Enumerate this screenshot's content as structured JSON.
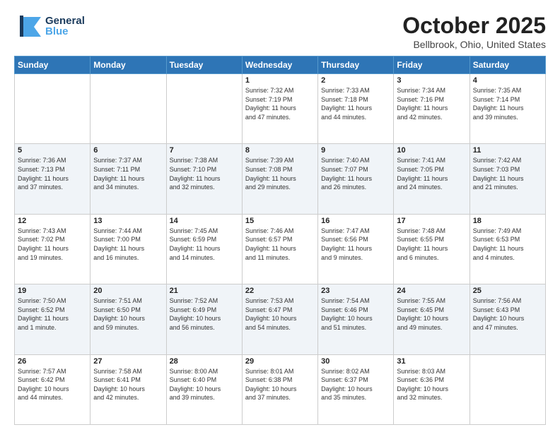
{
  "header": {
    "logo_general": "General",
    "logo_blue": "Blue",
    "month_title": "October 2025",
    "location": "Bellbrook, Ohio, United States"
  },
  "days_of_week": [
    "Sunday",
    "Monday",
    "Tuesday",
    "Wednesday",
    "Thursday",
    "Friday",
    "Saturday"
  ],
  "weeks": [
    [
      {
        "day": "",
        "info": ""
      },
      {
        "day": "",
        "info": ""
      },
      {
        "day": "",
        "info": ""
      },
      {
        "day": "1",
        "info": "Sunrise: 7:32 AM\nSunset: 7:19 PM\nDaylight: 11 hours\nand 47 minutes."
      },
      {
        "day": "2",
        "info": "Sunrise: 7:33 AM\nSunset: 7:18 PM\nDaylight: 11 hours\nand 44 minutes."
      },
      {
        "day": "3",
        "info": "Sunrise: 7:34 AM\nSunset: 7:16 PM\nDaylight: 11 hours\nand 42 minutes."
      },
      {
        "day": "4",
        "info": "Sunrise: 7:35 AM\nSunset: 7:14 PM\nDaylight: 11 hours\nand 39 minutes."
      }
    ],
    [
      {
        "day": "5",
        "info": "Sunrise: 7:36 AM\nSunset: 7:13 PM\nDaylight: 11 hours\nand 37 minutes."
      },
      {
        "day": "6",
        "info": "Sunrise: 7:37 AM\nSunset: 7:11 PM\nDaylight: 11 hours\nand 34 minutes."
      },
      {
        "day": "7",
        "info": "Sunrise: 7:38 AM\nSunset: 7:10 PM\nDaylight: 11 hours\nand 32 minutes."
      },
      {
        "day": "8",
        "info": "Sunrise: 7:39 AM\nSunset: 7:08 PM\nDaylight: 11 hours\nand 29 minutes."
      },
      {
        "day": "9",
        "info": "Sunrise: 7:40 AM\nSunset: 7:07 PM\nDaylight: 11 hours\nand 26 minutes."
      },
      {
        "day": "10",
        "info": "Sunrise: 7:41 AM\nSunset: 7:05 PM\nDaylight: 11 hours\nand 24 minutes."
      },
      {
        "day": "11",
        "info": "Sunrise: 7:42 AM\nSunset: 7:03 PM\nDaylight: 11 hours\nand 21 minutes."
      }
    ],
    [
      {
        "day": "12",
        "info": "Sunrise: 7:43 AM\nSunset: 7:02 PM\nDaylight: 11 hours\nand 19 minutes."
      },
      {
        "day": "13",
        "info": "Sunrise: 7:44 AM\nSunset: 7:00 PM\nDaylight: 11 hours\nand 16 minutes."
      },
      {
        "day": "14",
        "info": "Sunrise: 7:45 AM\nSunset: 6:59 PM\nDaylight: 11 hours\nand 14 minutes."
      },
      {
        "day": "15",
        "info": "Sunrise: 7:46 AM\nSunset: 6:57 PM\nDaylight: 11 hours\nand 11 minutes."
      },
      {
        "day": "16",
        "info": "Sunrise: 7:47 AM\nSunset: 6:56 PM\nDaylight: 11 hours\nand 9 minutes."
      },
      {
        "day": "17",
        "info": "Sunrise: 7:48 AM\nSunset: 6:55 PM\nDaylight: 11 hours\nand 6 minutes."
      },
      {
        "day": "18",
        "info": "Sunrise: 7:49 AM\nSunset: 6:53 PM\nDaylight: 11 hours\nand 4 minutes."
      }
    ],
    [
      {
        "day": "19",
        "info": "Sunrise: 7:50 AM\nSunset: 6:52 PM\nDaylight: 11 hours\nand 1 minute."
      },
      {
        "day": "20",
        "info": "Sunrise: 7:51 AM\nSunset: 6:50 PM\nDaylight: 10 hours\nand 59 minutes."
      },
      {
        "day": "21",
        "info": "Sunrise: 7:52 AM\nSunset: 6:49 PM\nDaylight: 10 hours\nand 56 minutes."
      },
      {
        "day": "22",
        "info": "Sunrise: 7:53 AM\nSunset: 6:47 PM\nDaylight: 10 hours\nand 54 minutes."
      },
      {
        "day": "23",
        "info": "Sunrise: 7:54 AM\nSunset: 6:46 PM\nDaylight: 10 hours\nand 51 minutes."
      },
      {
        "day": "24",
        "info": "Sunrise: 7:55 AM\nSunset: 6:45 PM\nDaylight: 10 hours\nand 49 minutes."
      },
      {
        "day": "25",
        "info": "Sunrise: 7:56 AM\nSunset: 6:43 PM\nDaylight: 10 hours\nand 47 minutes."
      }
    ],
    [
      {
        "day": "26",
        "info": "Sunrise: 7:57 AM\nSunset: 6:42 PM\nDaylight: 10 hours\nand 44 minutes."
      },
      {
        "day": "27",
        "info": "Sunrise: 7:58 AM\nSunset: 6:41 PM\nDaylight: 10 hours\nand 42 minutes."
      },
      {
        "day": "28",
        "info": "Sunrise: 8:00 AM\nSunset: 6:40 PM\nDaylight: 10 hours\nand 39 minutes."
      },
      {
        "day": "29",
        "info": "Sunrise: 8:01 AM\nSunset: 6:38 PM\nDaylight: 10 hours\nand 37 minutes."
      },
      {
        "day": "30",
        "info": "Sunrise: 8:02 AM\nSunset: 6:37 PM\nDaylight: 10 hours\nand 35 minutes."
      },
      {
        "day": "31",
        "info": "Sunrise: 8:03 AM\nSunset: 6:36 PM\nDaylight: 10 hours\nand 32 minutes."
      },
      {
        "day": "",
        "info": ""
      }
    ]
  ]
}
